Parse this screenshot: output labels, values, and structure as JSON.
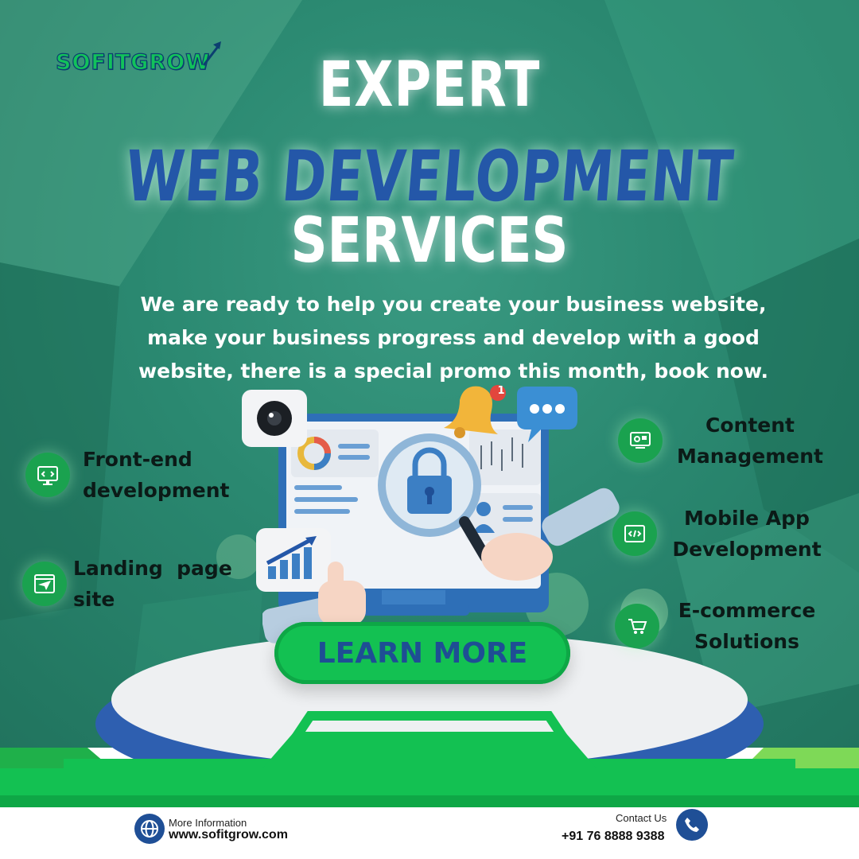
{
  "brand": {
    "logo_text": "SOFITGROW"
  },
  "headline": {
    "line1": "EXPERT",
    "line2": "WEB DEVELOPMENT",
    "line3": "SERVICES"
  },
  "description": {
    "line1": "We are ready to help you create your business website,",
    "line2": "make your business progress and develop with a good",
    "line3": "website, there is a special promo this month, book now."
  },
  "services": {
    "left": [
      {
        "line1": "Front-end",
        "line2": "development",
        "icon": "browser-code-icon"
      },
      {
        "line1": "Landing  page",
        "line2": "site",
        "icon": "paper-plane-icon"
      }
    ],
    "right": [
      {
        "line1": "Content",
        "line2": "Management",
        "icon": "monitor-settings-icon"
      },
      {
        "line1": "Mobile App",
        "line2": "Development",
        "icon": "code-window-icon"
      },
      {
        "line1": "E-commerce",
        "line2": "Solutions",
        "icon": "shopping-cart-icon"
      }
    ]
  },
  "illustration": {
    "notification_count": "1"
  },
  "cta": {
    "label": "LEARN MORE"
  },
  "footer": {
    "info_label": "More Information",
    "website": "www.sofitgrow.com",
    "contact_label": "Contact Us",
    "phone": "+91 76 8888 9388"
  },
  "colors": {
    "background": "#2a8870",
    "accent_green": "#13c152",
    "headline_blue": "#2457a8",
    "footer_icon": "#1f4f96"
  }
}
